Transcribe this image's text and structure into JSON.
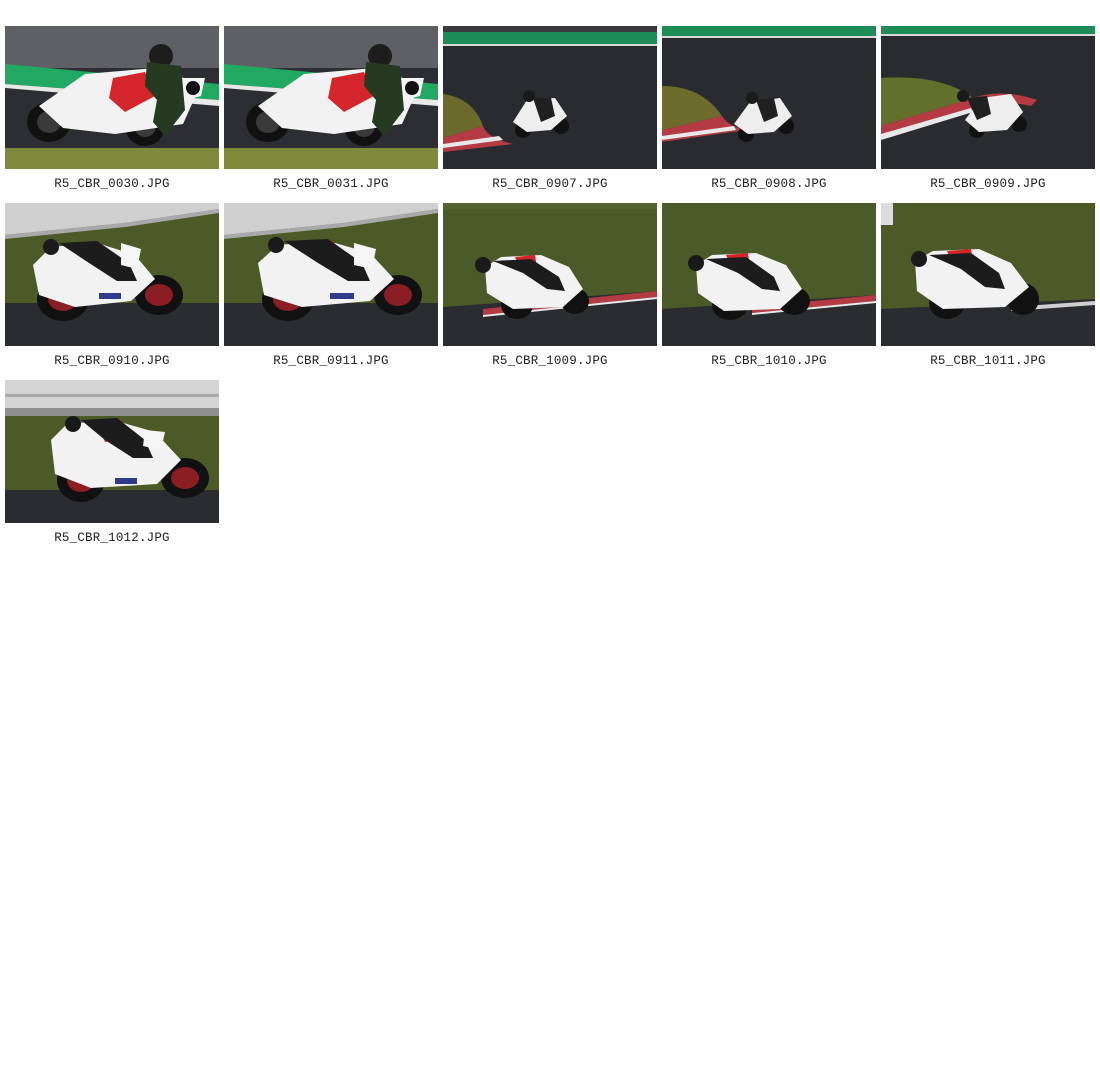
{
  "gallery": {
    "items": [
      {
        "filename": "R5_CBR_0030.JPG",
        "scene": "close-track"
      },
      {
        "filename": "R5_CBR_0031.JPG",
        "scene": "close-track"
      },
      {
        "filename": "R5_CBR_0907.JPG",
        "scene": "wide-corner-grass"
      },
      {
        "filename": "R5_CBR_0908.JPG",
        "scene": "wide-corner-grass"
      },
      {
        "filename": "R5_CBR_0909.JPG",
        "scene": "wide-corner-grass"
      },
      {
        "filename": "R5_CBR_0910.JPG",
        "scene": "side-grass-barrier"
      },
      {
        "filename": "R5_CBR_0911.JPG",
        "scene": "side-grass-barrier"
      },
      {
        "filename": "R5_CBR_1009.JPG",
        "scene": "side-grass-kerb"
      },
      {
        "filename": "R5_CBR_1010.JPG",
        "scene": "side-grass-kerb"
      },
      {
        "filename": "R5_CBR_1011.JPG",
        "scene": "side-grass-kerb"
      },
      {
        "filename": "R5_CBR_1012.JPG",
        "scene": "side-grass-barrier"
      }
    ]
  },
  "colors": {
    "background": "#ffffff",
    "caption_text": "#222222",
    "asphalt": "#2b2c2f",
    "grass": "#4d5a2b",
    "green_stripe": "#1e9a5c",
    "bike_white": "#f0f0f2",
    "bike_red": "#d4242c"
  }
}
